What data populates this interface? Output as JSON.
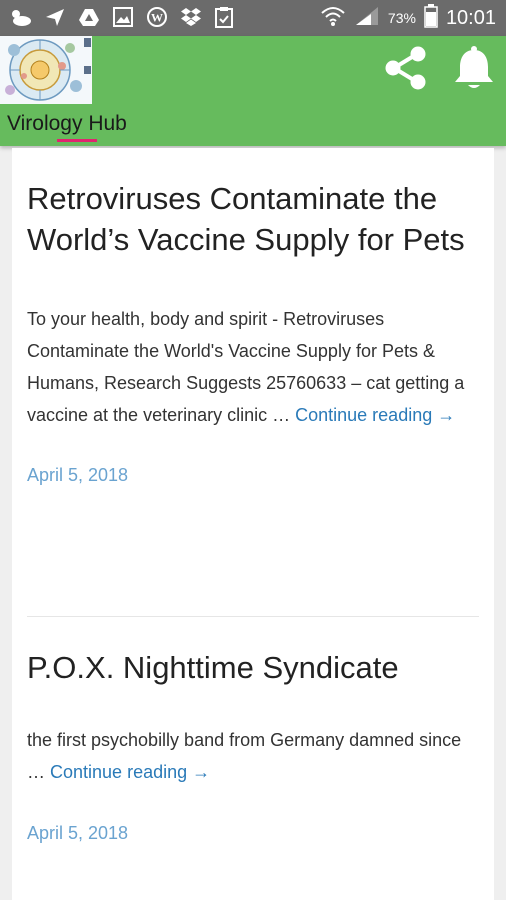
{
  "status_bar": {
    "battery_percent": "73%",
    "time": "10:01",
    "icons": [
      "weather-icon",
      "send-icon",
      "drive-icon",
      "gallery-icon",
      "wordpress-icon",
      "dropbox-icon",
      "clipboard-icon",
      "wifi-icon",
      "signal-icon",
      "battery-icon"
    ]
  },
  "app_bar": {
    "title": "Virology Hub",
    "icons": [
      "share-icon",
      "bell-icon"
    ],
    "color": "#66bb5d"
  },
  "posts": [
    {
      "title": "Retroviruses Contaminate the World’s Vaccine Supply for Pets",
      "excerpt": "To your health, body and spirit - Retroviruses Contaminate the World's Vaccine Supply for Pets & Humans, Research Suggests 25760633 – cat getting a vaccine at the veterinary clinic …",
      "continue_label": "Continue reading →",
      "date": "April 5, 2018"
    },
    {
      "title": "P.O.X. Nighttime Syndicate",
      "excerpt": "the first psychobilly band from Germany damned since …",
      "continue_label": "Continue reading →",
      "date": "April 5, 2018"
    }
  ],
  "colors": {
    "link": "#2a7ab8",
    "date": "#6aa3d0"
  }
}
